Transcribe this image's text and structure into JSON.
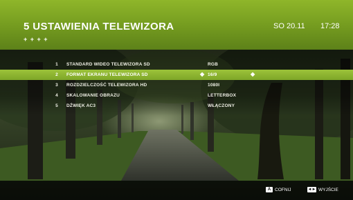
{
  "header": {
    "title": "5  USTAWIENIA TELEWIZORA",
    "dots": "+ + + +",
    "date": "SO 20.11",
    "time": "17:28"
  },
  "menu": {
    "items": [
      {
        "num": "1",
        "label": "STANDARD WIDEO TELEWIZORA SD",
        "value": "RGB"
      },
      {
        "num": "2",
        "label": "FORMAT EKRANU TELEWIZORA SD",
        "value": "16/9"
      },
      {
        "num": "3",
        "label": "ROZDZIELCZOŚĆ TELEWIZORA HD",
        "value": "1080i"
      },
      {
        "num": "4",
        "label": "SKALOWANIE OBRAZU",
        "value": "LETTERBOX"
      },
      {
        "num": "5",
        "label": "DŹWIĘK AC3",
        "value": "WŁĄCZONY"
      }
    ],
    "selected_index": 1,
    "arrow_left": "◆",
    "arrow_right": "◆"
  },
  "footer": {
    "back_key": "A",
    "back_label": "COFNIJ",
    "exit_key": "◄►",
    "exit_label": "WYJŚCIE"
  },
  "colors": {
    "accent_green": "#8fb62a",
    "selected_row": "#9cc33a"
  },
  "icons": {
    "back": "back-key-icon",
    "exit": "exit-key-icon"
  }
}
